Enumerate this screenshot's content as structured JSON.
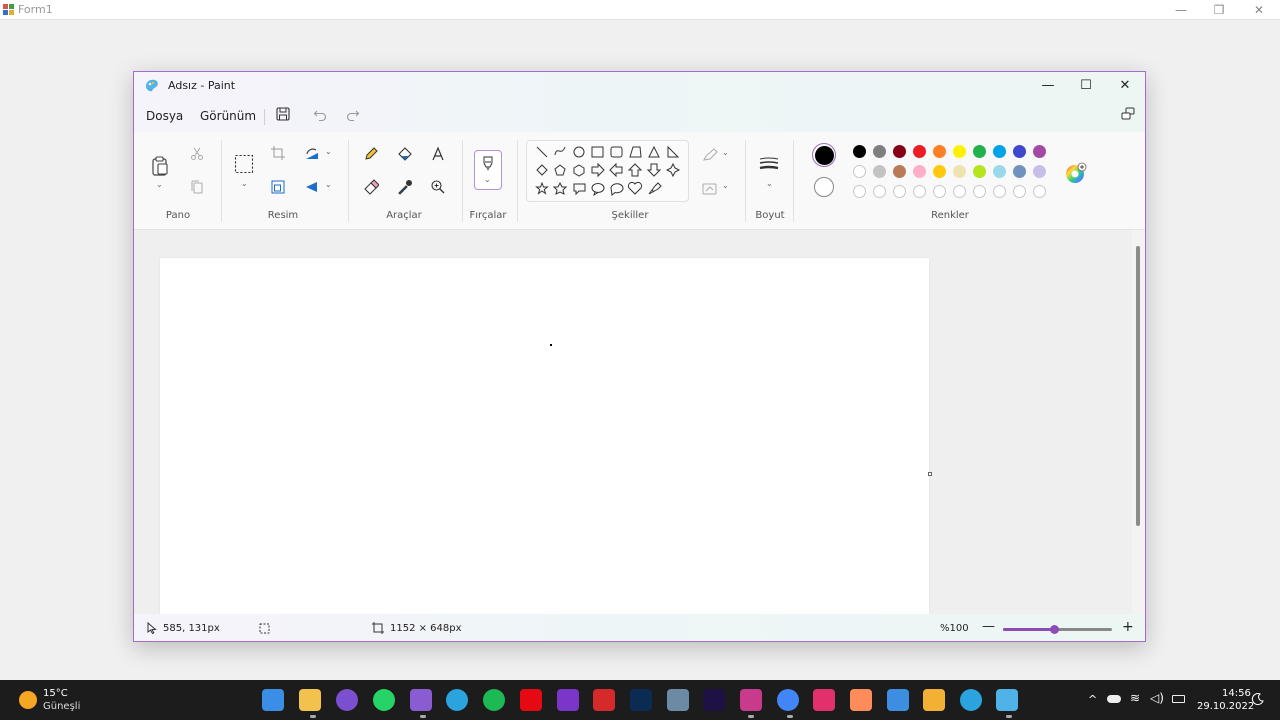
{
  "outer_window": {
    "title": "Form1"
  },
  "paint": {
    "title": "Adsız - Paint",
    "menu": {
      "file": "Dosya",
      "view": "Görünüm"
    },
    "groups": {
      "clipboard": "Pano",
      "image": "Resim",
      "tools": "Araçlar",
      "brushes": "Fırçalar",
      "shapes": "Şekiller",
      "size": "Boyut",
      "colors": "Renkler"
    },
    "colors": {
      "primary": "#000000",
      "secondary": "#ffffff",
      "row1": [
        "#000000",
        "#7f7f7f",
        "#880015",
        "#ed1c24",
        "#ff7f27",
        "#fff200",
        "#22b14c",
        "#00a2e8",
        "#3f48cc",
        "#a349a4"
      ],
      "row2": [
        "#ffffff",
        "#c3c3c3",
        "#b97a57",
        "#ffaec9",
        "#ffc90e",
        "#efe4b0",
        "#b5e61d",
        "#99d9ea",
        "#7092be",
        "#c8bfe7"
      ],
      "row3_custom_empty": 10
    },
    "status": {
      "cursor_position": "585, 131px",
      "canvas_size": "1152 × 648px",
      "zoom": "%100",
      "zoom_level": 0.47
    }
  },
  "taskbar": {
    "weather_temp": "15°C",
    "weather_desc": "Güneşli",
    "time": "14:56",
    "date": "29.10.2022",
    "apps": [
      "start",
      "explorer",
      "github",
      "whatsapp",
      "visual-studio",
      "telegram",
      "spotify",
      "netflix",
      "jetbrains",
      "swiftkey",
      "photoshop",
      "calculator",
      "premiere",
      "snipping-tool",
      "chrome",
      "instagram",
      "photos",
      "notepad",
      "winforms",
      "telegram-2",
      "paint"
    ]
  }
}
